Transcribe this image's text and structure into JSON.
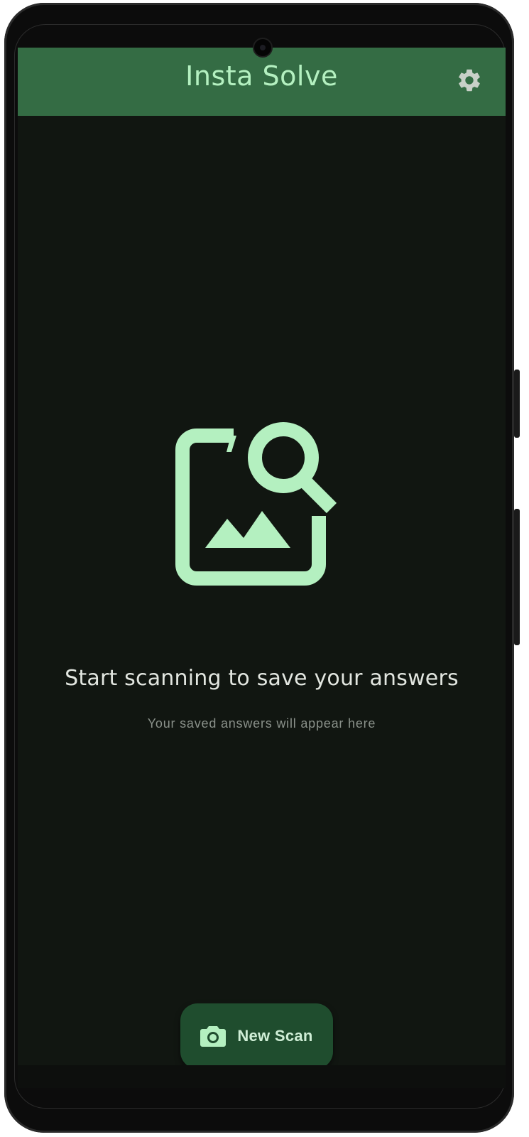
{
  "app_bar": {
    "title": "Insta Solve",
    "settings_icon": "gear-icon"
  },
  "empty_state": {
    "icon": "image-search-icon",
    "title": "Start scanning to save your answers",
    "subtitle": "Your saved answers will appear here"
  },
  "fab": {
    "icon": "camera-icon",
    "label": "New Scan"
  },
  "colors": {
    "app_bar": "#346c44",
    "accent": "#b4f0c0",
    "background": "#111611",
    "fab_background": "#1f4d2e"
  }
}
